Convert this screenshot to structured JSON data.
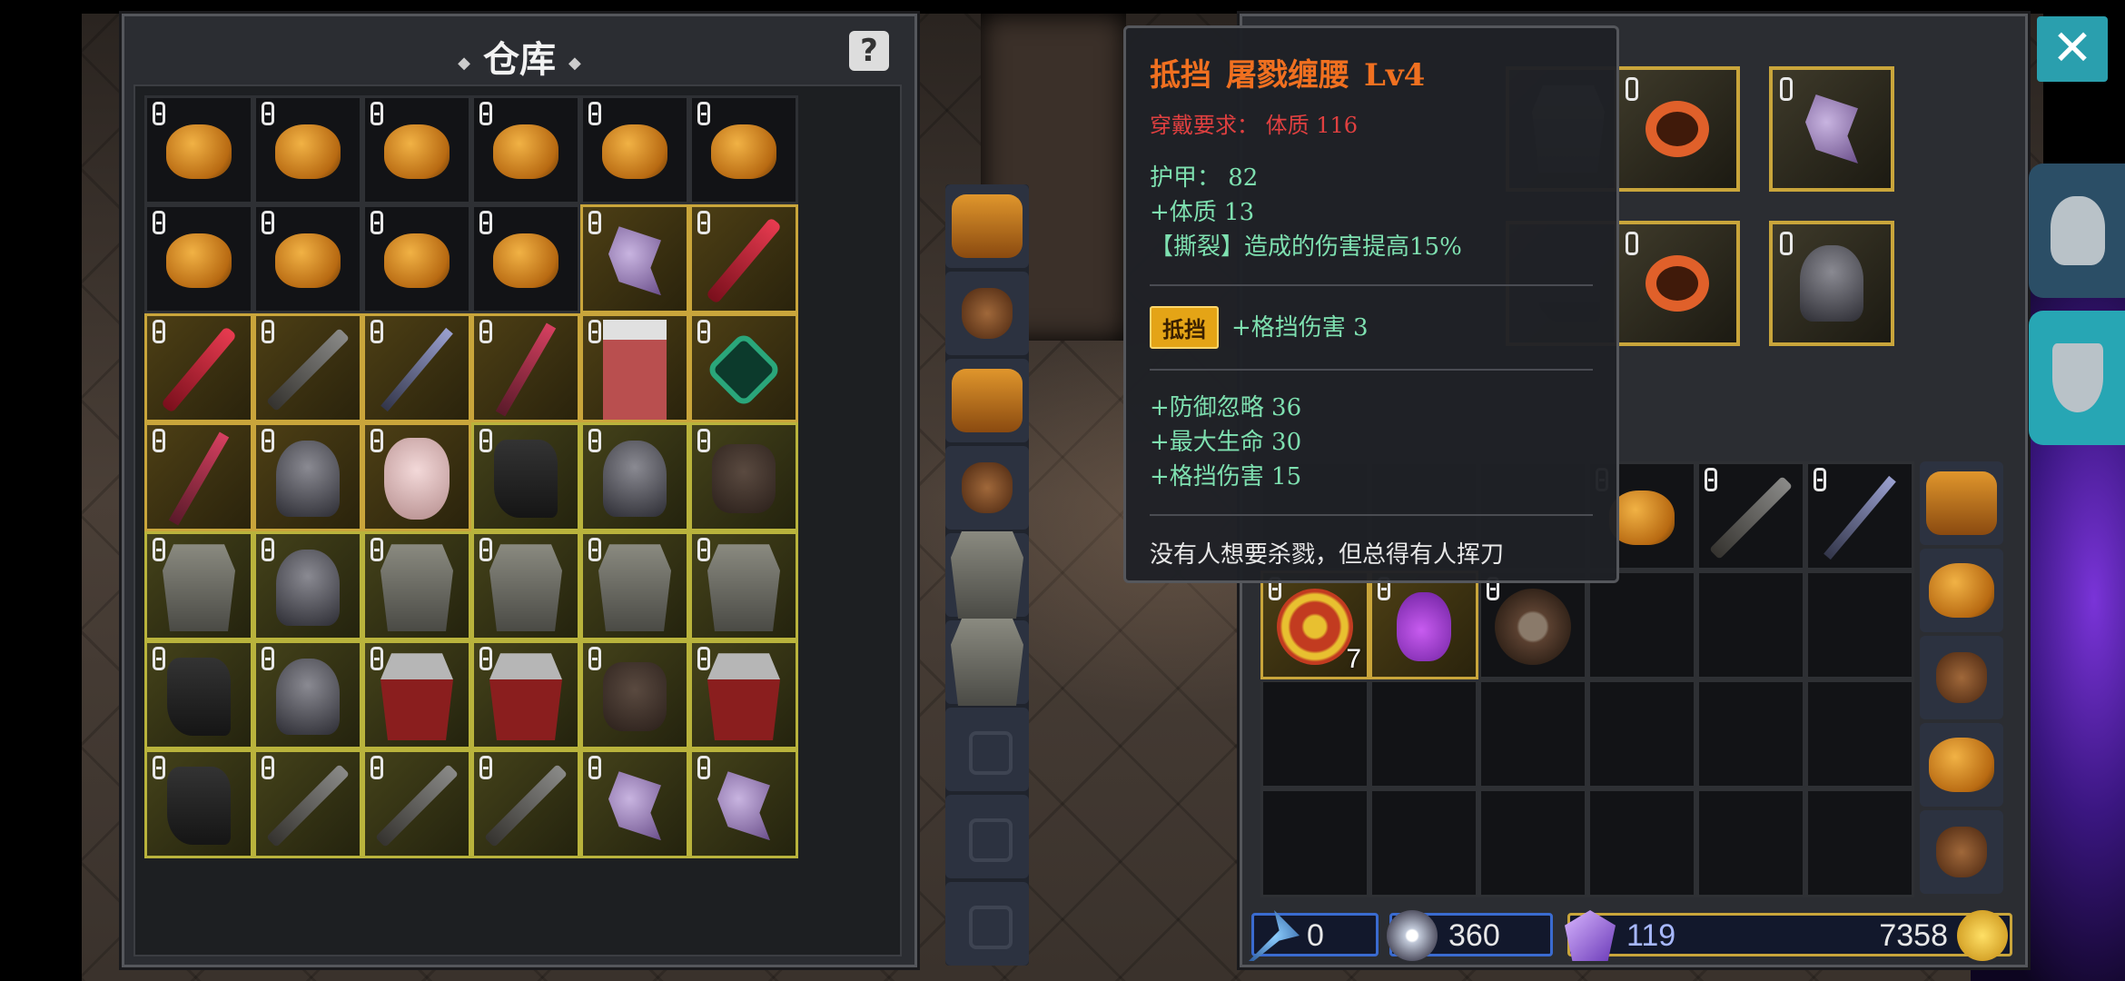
{
  "warehouse": {
    "title": "仓库",
    "help_label": "?",
    "grid": [
      [
        {
          "icon": "pouch-icon",
          "tier": "none"
        },
        {
          "icon": "pouch-icon",
          "tier": "none"
        },
        {
          "icon": "pouch-icon",
          "tier": "none"
        },
        {
          "icon": "pouch-icon",
          "tier": "none"
        },
        {
          "icon": "pouch-icon",
          "tier": "none"
        },
        {
          "icon": "pouch-icon",
          "tier": "none"
        }
      ],
      [
        {
          "icon": "pouch-icon",
          "tier": "none"
        },
        {
          "icon": "pouch-icon",
          "tier": "none"
        },
        {
          "icon": "pouch-icon",
          "tier": "none"
        },
        {
          "icon": "pouch-icon",
          "tier": "none"
        },
        {
          "icon": "axe-icon",
          "tier": "gold"
        },
        {
          "icon": "blade-icon",
          "tier": "gold"
        }
      ],
      [
        {
          "icon": "blade-icon",
          "tier": "gold"
        },
        {
          "icon": "sword-icon",
          "tier": "gold"
        },
        {
          "icon": "spear-icon",
          "tier": "gold"
        },
        {
          "icon": "staff-icon",
          "tier": "gold"
        },
        {
          "icon": "robe-icon",
          "tier": "gold"
        },
        {
          "icon": "necklace-icon",
          "tier": "gold"
        }
      ],
      [
        {
          "icon": "staff-icon",
          "tier": "gold"
        },
        {
          "icon": "helm-icon",
          "tier": "gold"
        },
        {
          "icon": "mask-icon",
          "tier": "gold"
        },
        {
          "icon": "boot-icon",
          "tier": "yellow"
        },
        {
          "icon": "helm-icon",
          "tier": "yellow"
        },
        {
          "icon": "glove-icon",
          "tier": "yellow"
        }
      ],
      [
        {
          "icon": "chest-icon",
          "tier": "yellow"
        },
        {
          "icon": "helm-icon",
          "tier": "yellow"
        },
        {
          "icon": "chest-icon",
          "tier": "yellow"
        },
        {
          "icon": "chest-icon",
          "tier": "yellow"
        },
        {
          "icon": "chest-icon",
          "tier": "yellow"
        },
        {
          "icon": "chest-icon",
          "tier": "yellow"
        }
      ],
      [
        {
          "icon": "boot-icon",
          "tier": "yellow"
        },
        {
          "icon": "helm-icon",
          "tier": "yellow"
        },
        {
          "icon": "redchest-icon",
          "tier": "yellow"
        },
        {
          "icon": "redchest-icon",
          "tier": "yellow"
        },
        {
          "icon": "glove-icon",
          "tier": "yellow"
        },
        {
          "icon": "redchest-icon",
          "tier": "yellow"
        }
      ],
      [
        {
          "icon": "boot-icon",
          "tier": "yellow"
        },
        {
          "icon": "sword-icon",
          "tier": "yellow"
        },
        {
          "icon": "sword-icon",
          "tier": "yellow"
        },
        {
          "icon": "sword-icon",
          "tier": "yellow"
        },
        {
          "icon": "axe-icon",
          "tier": "yellow"
        },
        {
          "icon": "axe-icon",
          "tier": "yellow"
        }
      ]
    ],
    "side_bags": [
      "bag-icon",
      "pouch2-icon",
      "bag-icon",
      "pouch2-icon",
      "chest-icon",
      "chest-icon",
      "empty",
      "empty",
      "empty"
    ],
    "pages": {
      "count": 3,
      "active": 1
    }
  },
  "tooltip": {
    "type_label": "抵挡",
    "item_name": "屠戮缠腰",
    "level": "Lv4",
    "requirement": "穿戴要求： 体质 116",
    "base_stats": [
      "护甲： 82",
      "+体质 13",
      "【撕裂】造成的伤害提高15%"
    ],
    "block_tag": "抵挡",
    "block_stat": "+格挡伤害 3",
    "bonus_stats": [
      "+防御忽略 36",
      "+最大生命 30",
      "+格挡伤害 15"
    ],
    "flavor": "没有人想要杀戮，但总得有人挥刀"
  },
  "equipment": [
    "chest-icon",
    "ring-icon",
    "axe-icon",
    "boot-icon",
    "ring-icon",
    "helm-icon"
  ],
  "inventory": {
    "grid": [
      [
        {
          "icon": "empty"
        },
        {
          "icon": "empty"
        },
        {
          "icon": "empty"
        },
        {
          "icon": "pouch-icon"
        },
        {
          "icon": "sword-icon"
        },
        {
          "icon": "spear-icon"
        }
      ],
      [
        {
          "icon": "scroll-icon",
          "count": "7",
          "tier": "gold"
        },
        {
          "icon": "potion-icon",
          "tier": "gold"
        },
        {
          "icon": "shield-icon"
        },
        {
          "icon": "empty"
        },
        {
          "icon": "empty"
        },
        {
          "icon": "empty"
        }
      ],
      [
        {
          "icon": "empty"
        },
        {
          "icon": "empty"
        },
        {
          "icon": "empty"
        },
        {
          "icon": "empty"
        },
        {
          "icon": "empty"
        },
        {
          "icon": "empty"
        }
      ],
      [
        {
          "icon": "empty"
        },
        {
          "icon": "empty"
        },
        {
          "icon": "empty"
        },
        {
          "icon": "empty"
        },
        {
          "icon": "empty"
        },
        {
          "icon": "empty"
        }
      ]
    ],
    "side_bags": [
      "bag-icon",
      "pouch-icon",
      "pouch2-icon",
      "pouch-icon",
      "pouch2-icon"
    ]
  },
  "currency": {
    "wand": "0",
    "gems": "360",
    "crystals": "119",
    "gold": "7358"
  },
  "close_label": "✕"
}
